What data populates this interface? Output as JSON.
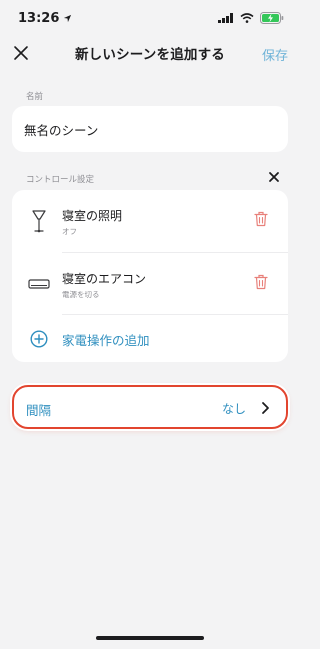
{
  "status_bar": {
    "time": "13:26"
  },
  "nav": {
    "title": "新しいシーンを追加する",
    "save_label": "保存"
  },
  "name_section": {
    "label": "名前",
    "value": "無名のシーン"
  },
  "control_section": {
    "label": "コントロール設定",
    "items": [
      {
        "name": "寝室の照明",
        "status": "オフ",
        "icon": "floor-lamp-icon"
      },
      {
        "name": "寝室のエアコン",
        "status": "電源を切る",
        "icon": "air-conditioner-icon"
      }
    ],
    "add_label": "家電操作の追加"
  },
  "interval": {
    "label": "間隔",
    "value": "なし"
  },
  "colors": {
    "accent": "#2f8fbf",
    "save": "#6fb3d8",
    "delete": "#e8807a",
    "highlight": "#e2452f"
  }
}
